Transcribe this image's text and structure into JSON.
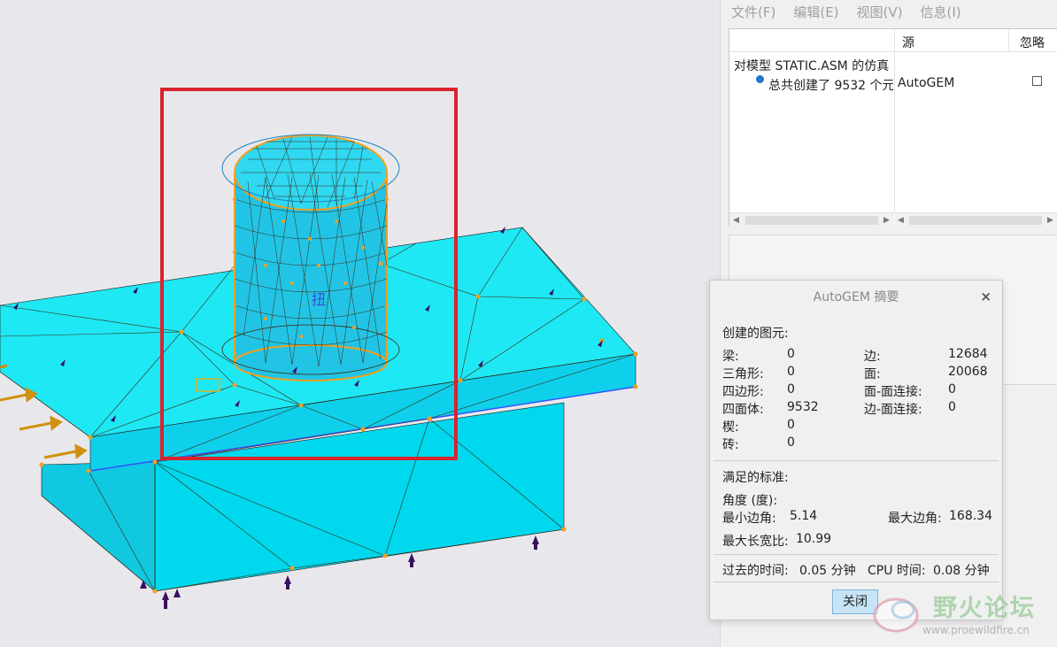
{
  "menu": {
    "file": "文件(F)",
    "edit": "编辑(E)",
    "view": "视图(V)",
    "info": "信息(I)"
  },
  "message_table": {
    "headers": {
      "source": "源",
      "ignore": "忽略"
    },
    "rows": [
      {
        "message": "对模型 STATIC.ASM 的仿真",
        "source": ""
      },
      {
        "message": "总共创建了 9532 个元",
        "source": "AutoGEM"
      }
    ]
  },
  "dialog": {
    "title": "AutoGEM 摘要",
    "close_symbol": "×",
    "elements_heading": "创建的图元:",
    "elements_left": [
      {
        "label": "梁:",
        "value": "0"
      },
      {
        "label": "三角形:",
        "value": "0"
      },
      {
        "label": "四边形:",
        "value": "0"
      },
      {
        "label": "四面体:",
        "value": "9532"
      },
      {
        "label": "楔:",
        "value": "0"
      },
      {
        "label": "砖:",
        "value": "0"
      }
    ],
    "elements_right": [
      {
        "label": "边:",
        "value": "12684"
      },
      {
        "label": "面:",
        "value": "20068"
      },
      {
        "label": "面-面连接:",
        "value": "0"
      },
      {
        "label": "边-面连接:",
        "value": "0"
      }
    ],
    "criteria_heading": "满足的标准:",
    "angle_heading": "角度 (度):",
    "min_angle_label": "最小边角:",
    "min_angle_value": "5.14",
    "max_angle_label": "最大边角:",
    "max_angle_value": "168.34",
    "aspect_label": "最大长宽比:",
    "aspect_value": "10.99",
    "elapsed_label": "过去的时间:",
    "elapsed_value": "0.05 分钟",
    "cpu_label": "CPU 时间:",
    "cpu_value": "0.08 分钟",
    "close_button": "关闭"
  },
  "viewport": {
    "load_label": "扭",
    "colors": {
      "body": "#00e5f0",
      "mesh": "#3a2a10",
      "node": "#f0a020",
      "highlight_box": "#d8242e",
      "constraint": "#3a1060",
      "load_arrow": "#d09010"
    }
  },
  "watermark": {
    "text": "野火论坛",
    "url": "www.proewildfire.cn"
  }
}
